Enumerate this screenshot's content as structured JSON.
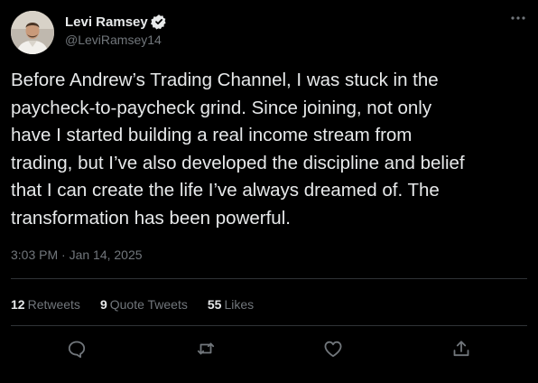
{
  "author": {
    "display_name": "Levi Ramsey",
    "handle": "@LeviRamsey14",
    "verified": true
  },
  "tweet": {
    "text": "Before Andrew’s Trading Channel, I was stuck in the\npaycheck-to-paycheck grind. Since joining, not only\nhave I started building a real income stream from\ntrading, but I’ve also developed the discipline and belief\nthat I can create the life I’ve always dreamed of. The\ntransformation has been powerful.",
    "timestamp": "3:03 PM · Jan 14, 2025"
  },
  "stats": {
    "retweets": {
      "count": "12",
      "label": "Retweets"
    },
    "quote_tweets": {
      "count": "9",
      "label": "Quote Tweets"
    },
    "likes": {
      "count": "55",
      "label": "Likes"
    }
  },
  "actions": {
    "reply_icon": "reply-icon",
    "retweet_icon": "retweet-icon",
    "like_icon": "heart-icon",
    "share_icon": "share-icon"
  },
  "colors": {
    "background": "#000000",
    "primary_text": "#e7e9ea",
    "secondary_text": "#71767b",
    "divider": "#2f3336"
  }
}
